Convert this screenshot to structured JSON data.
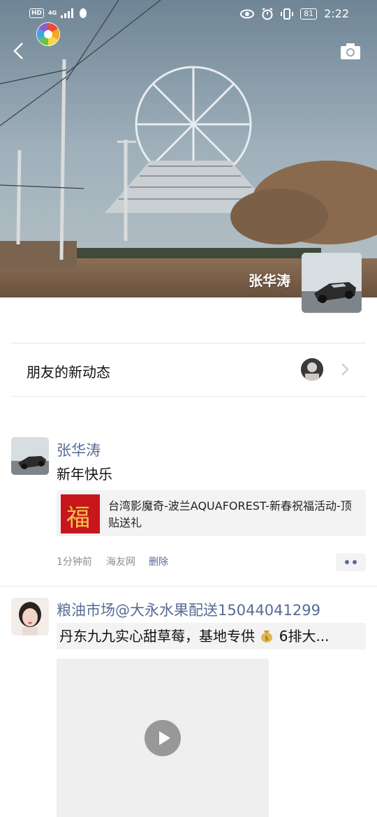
{
  "status_bar": {
    "hd": "HD",
    "network": "4G",
    "battery": "81",
    "time": "2:22"
  },
  "cover": {
    "owner_name": "张华涛"
  },
  "friends_updates": {
    "label": "朋友的新动态"
  },
  "posts": [
    {
      "author": "张华涛",
      "text": "新年快乐",
      "link_title": "台湾影魔奇-波兰AQUAFOREST-新春祝福活动-顶贴送礼",
      "link_thumb_char": "福",
      "time": "1分钟前",
      "source": "海友网",
      "delete_label": "删除"
    },
    {
      "author": "粮油市场@大永水果配送15044041299",
      "text_part1": "丹东九九实心甜草莓，基地专供 ",
      "text_part2": "6排大..."
    }
  ],
  "icons": {
    "back": "back-arrow-icon",
    "camera": "camera-icon",
    "chevron": "chevron-right-icon",
    "play": "play-icon",
    "more": "more-dots-icon"
  },
  "colors": {
    "name_link": "#576b95",
    "meta": "#8e8e8e",
    "card_bg": "#f3f3f3"
  }
}
